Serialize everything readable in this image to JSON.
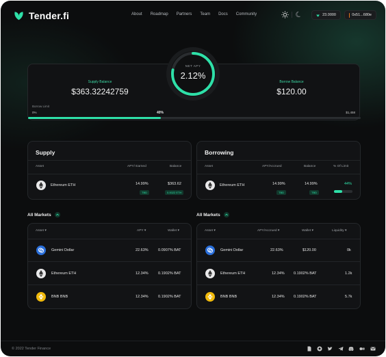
{
  "brand": {
    "name": "Tender.fi"
  },
  "nav": [
    "About",
    "Roadmap",
    "Partners",
    "Team",
    "Docs",
    "Community"
  ],
  "header": {
    "tnd_balance": "23.0000",
    "account": "0x51...680e"
  },
  "balances": {
    "supply_label": "Supply Balance",
    "supply_value": "$363.32242759",
    "borrow_label": "Borrow Balance",
    "borrow_value": "$120.00",
    "net_apy_label": "NET APY",
    "net_apy_value": "2.12%",
    "net_apy_fraction": 0.78,
    "borrow_limit_label": "Borrow Limit",
    "limit_start": "0%",
    "limit_percent": "40%",
    "limit_fraction": 0.4,
    "limit_max": "$1,458"
  },
  "supply_panel": {
    "title": "Supply",
    "headers": {
      "asset": "Asset",
      "apy": "APY/ Earned",
      "balance": "Balance"
    },
    "row": {
      "asset": "Ethereum ETH",
      "apy": "14.99%",
      "apy_tag": "TBD",
      "balance": "$363.62",
      "balance_tag": "0.0022 ETH"
    }
  },
  "borrow_panel": {
    "title": "Borrowing",
    "headers": {
      "asset": "Asset",
      "apy": "APY/Accrued",
      "balance": "Balance",
      "limit": "% Of Limit"
    },
    "row": {
      "asset": "Ethereum ETH",
      "apy": "14.99%",
      "apy_tag": "TBD",
      "balance": "14.99%",
      "balance_tag": "TBD",
      "limit": "44%",
      "limit_fraction": 0.44
    }
  },
  "supply_markets": {
    "title": "All Markets",
    "headers": {
      "asset": "Asset",
      "apy": "APY",
      "wallet": "Wallet"
    },
    "rows": [
      {
        "asset": "Gemini Dollar",
        "apy": "22.63%",
        "wallet": "0.0907% BAT"
      },
      {
        "asset": "Ethereum ETH",
        "apy": "12.34%",
        "wallet": "0.1902% BAT"
      },
      {
        "asset": "BNB BNB",
        "apy": "12.34%",
        "wallet": "0.1902% BAT"
      }
    ]
  },
  "borrow_markets": {
    "title": "All Markets",
    "headers": {
      "asset": "Asset",
      "apy": "APY/Accrued",
      "wallet": "Wallet",
      "liquidity": "Liquidity"
    },
    "rows": [
      {
        "asset": "Gemini Dollar",
        "apy": "22.63%",
        "wallet": "$120.00",
        "liquidity": "0k"
      },
      {
        "asset": "Ethereum ETH",
        "apy": "12.34%",
        "wallet": "0.1902% BAT",
        "liquidity": "1.2k"
      },
      {
        "asset": "BNB BNB",
        "apy": "12.34%",
        "wallet": "0.1902% BAT",
        "liquidity": "5.7k"
      }
    ]
  },
  "footer": {
    "copyright": "© 2022 Tender Finance",
    "socials": [
      "docs-icon",
      "github-icon",
      "twitter-icon",
      "telegram-icon",
      "discord-icon",
      "medium-icon",
      "mail-icon"
    ]
  },
  "colors": {
    "accent": "#2ee0a8",
    "background": "#0c0d0e",
    "panel": "#121315"
  }
}
